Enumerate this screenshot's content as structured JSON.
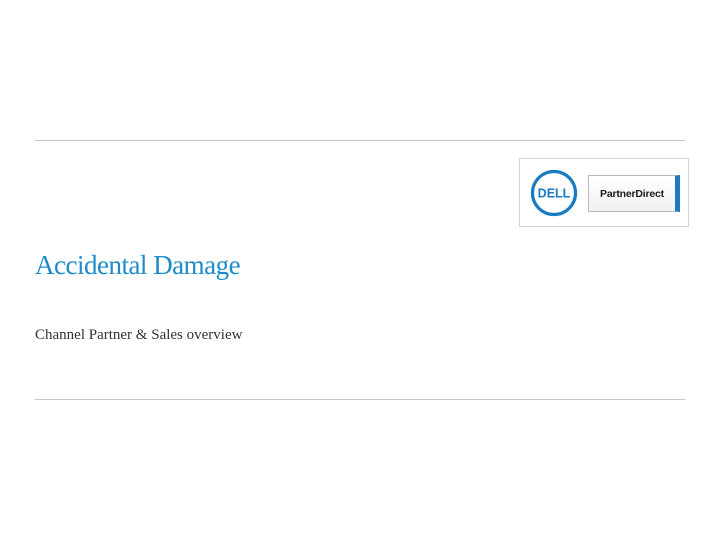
{
  "slide": {
    "title": "Accidental Damage",
    "subtitle": "Channel Partner & Sales overview"
  },
  "logo": {
    "brand": "DELL",
    "program": "PartnerDirect"
  },
  "colors": {
    "title": "#1d8cc8",
    "dell_blue": "#1b7bc1",
    "rule": "#c8c8c8",
    "subtitle": "#333333"
  }
}
